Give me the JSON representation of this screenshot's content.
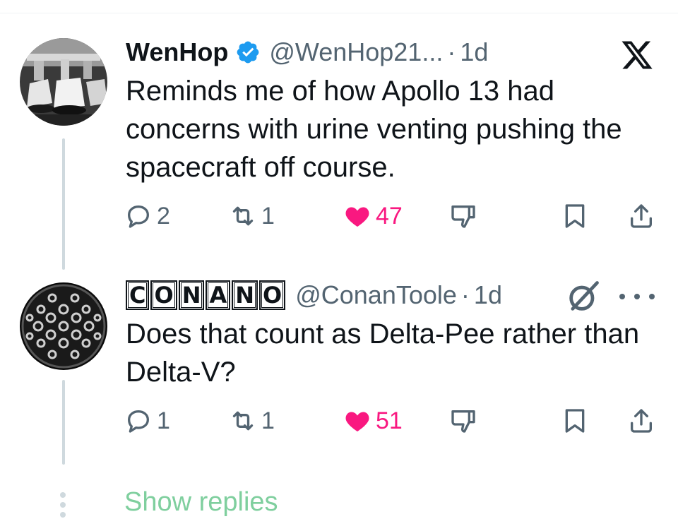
{
  "tweets": [
    {
      "name": "WenHop",
      "handle": "@WenHop21...",
      "dot": "·",
      "time": "1d",
      "text": "Reminds me of how Apollo 13 had concerns with urine venting pushing the spacecraft off course.",
      "replies": "2",
      "reposts": "1",
      "likes": "47",
      "verified": true
    },
    {
      "name_letters": [
        "C",
        "O",
        "N",
        "A",
        "N",
        "O"
      ],
      "handle": "@ConanToole",
      "dot": "·",
      "time": "1d",
      "text": "Does that count as Delta-Pee rather than Delta-V?",
      "replies": "1",
      "reposts": "1",
      "likes": "51"
    }
  ],
  "show_replies": "Show replies",
  "icons": {
    "brand": "x-logo-icon",
    "verified": "verified-badge-icon",
    "reply": "reply-icon",
    "repost": "repost-icon",
    "like": "heart-icon",
    "dislike": "dislike-icon",
    "bookmark": "bookmark-icon",
    "share": "share-icon",
    "grok": "grok-icon",
    "more": "more-icon"
  },
  "colors": {
    "text": "#0f1419",
    "secondary": "#536471",
    "like": "#f91880",
    "verified": "#1d9bf0",
    "show_replies": "#7fcf9e",
    "thread_line": "#cfd9de"
  }
}
